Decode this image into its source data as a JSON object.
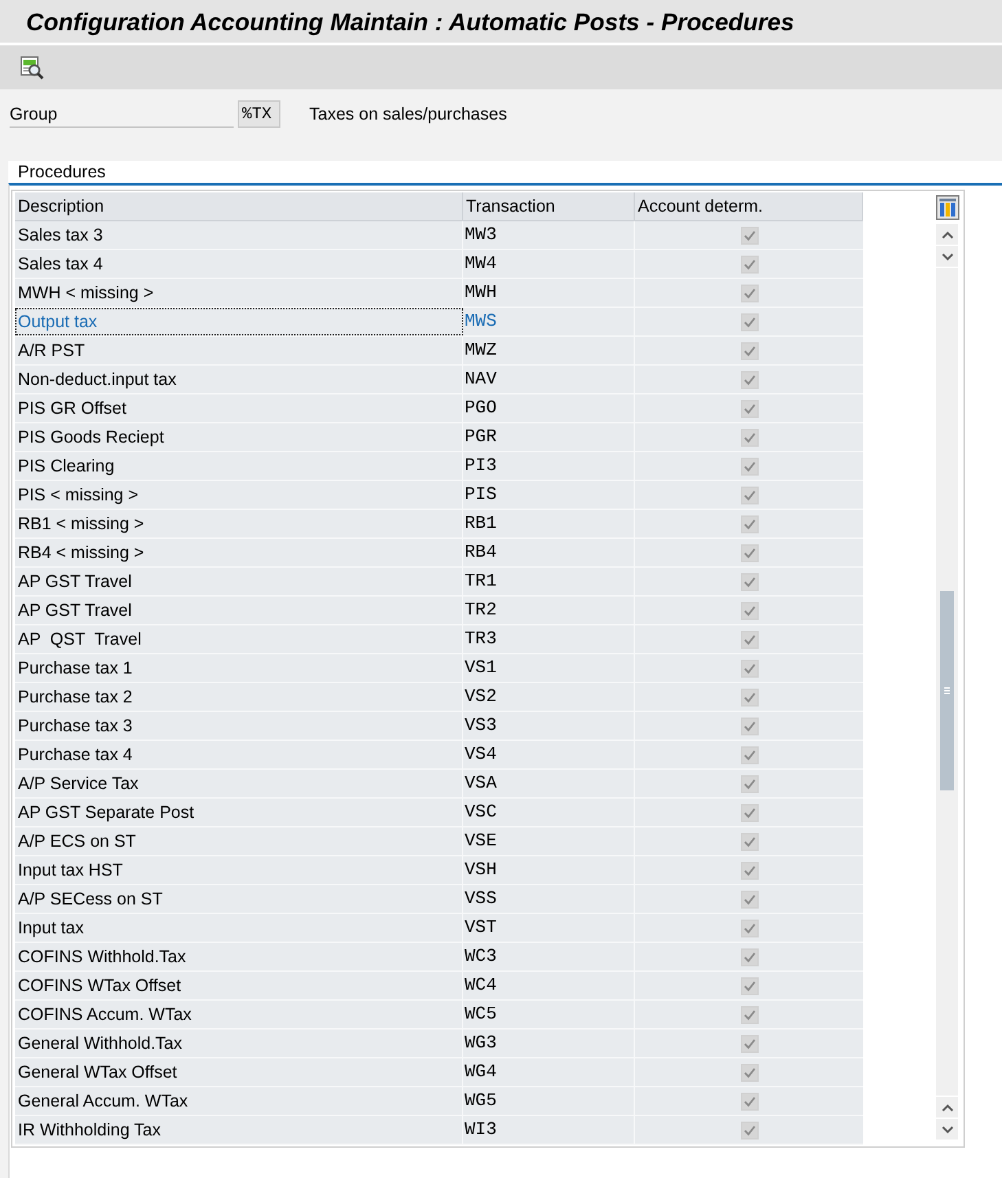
{
  "window": {
    "title": "Configuration Accounting Maintain : Automatic Posts - Procedures"
  },
  "group": {
    "label": "Group",
    "value": "%TX",
    "description": "Taxes on sales/purchases"
  },
  "tabs": [
    {
      "label": "Procedures",
      "selected": true
    }
  ],
  "table": {
    "columns": [
      "Description",
      "Transaction",
      "Account determ."
    ],
    "rows": [
      {
        "description": "Sales tax 3",
        "transaction": "MW3",
        "account_determ": {
          "checked": true,
          "disabled": true
        },
        "selected": false
      },
      {
        "description": "Sales tax 4",
        "transaction": "MW4",
        "account_determ": {
          "checked": true,
          "disabled": true
        },
        "selected": false
      },
      {
        "description": "MWH < missing >",
        "transaction": "MWH",
        "account_determ": {
          "checked": true,
          "disabled": true
        },
        "selected": false
      },
      {
        "description": "Output tax",
        "transaction": "MWS",
        "account_determ": {
          "checked": true,
          "disabled": true
        },
        "selected": true
      },
      {
        "description": "A/R PST",
        "transaction": "MWZ",
        "account_determ": {
          "checked": true,
          "disabled": true
        },
        "selected": false
      },
      {
        "description": "Non-deduct.input tax",
        "transaction": "NAV",
        "account_determ": {
          "checked": true,
          "disabled": true
        },
        "selected": false
      },
      {
        "description": "PIS GR Offset",
        "transaction": "PGO",
        "account_determ": {
          "checked": true,
          "disabled": true
        },
        "selected": false
      },
      {
        "description": "PIS Goods Reciept",
        "transaction": "PGR",
        "account_determ": {
          "checked": true,
          "disabled": true
        },
        "selected": false
      },
      {
        "description": "PIS Clearing",
        "transaction": "PI3",
        "account_determ": {
          "checked": true,
          "disabled": true
        },
        "selected": false
      },
      {
        "description": "PIS < missing >",
        "transaction": "PIS",
        "account_determ": {
          "checked": true,
          "disabled": true
        },
        "selected": false
      },
      {
        "description": "RB1 < missing >",
        "transaction": "RB1",
        "account_determ": {
          "checked": true,
          "disabled": true
        },
        "selected": false
      },
      {
        "description": "RB4 < missing >",
        "transaction": "RB4",
        "account_determ": {
          "checked": true,
          "disabled": true
        },
        "selected": false
      },
      {
        "description": "AP GST Travel",
        "transaction": "TR1",
        "account_determ": {
          "checked": true,
          "disabled": true
        },
        "selected": false
      },
      {
        "description": "AP GST Travel",
        "transaction": "TR2",
        "account_determ": {
          "checked": true,
          "disabled": true
        },
        "selected": false
      },
      {
        "description": "AP  QST  Travel",
        "transaction": "TR3",
        "account_determ": {
          "checked": true,
          "disabled": true
        },
        "selected": false
      },
      {
        "description": "Purchase tax 1",
        "transaction": "VS1",
        "account_determ": {
          "checked": true,
          "disabled": true
        },
        "selected": false
      },
      {
        "description": "Purchase tax 2",
        "transaction": "VS2",
        "account_determ": {
          "checked": true,
          "disabled": true
        },
        "selected": false
      },
      {
        "description": "Purchase tax 3",
        "transaction": "VS3",
        "account_determ": {
          "checked": true,
          "disabled": true
        },
        "selected": false
      },
      {
        "description": "Purchase tax 4",
        "transaction": "VS4",
        "account_determ": {
          "checked": true,
          "disabled": true
        },
        "selected": false
      },
      {
        "description": "A/P Service Tax",
        "transaction": "VSA",
        "account_determ": {
          "checked": true,
          "disabled": true
        },
        "selected": false
      },
      {
        "description": "AP GST Separate Post",
        "transaction": "VSC",
        "account_determ": {
          "checked": true,
          "disabled": true
        },
        "selected": false
      },
      {
        "description": "A/P ECS on ST",
        "transaction": "VSE",
        "account_determ": {
          "checked": true,
          "disabled": true
        },
        "selected": false
      },
      {
        "description": "Input tax HST",
        "transaction": "VSH",
        "account_determ": {
          "checked": true,
          "disabled": true
        },
        "selected": false
      },
      {
        "description": "A/P SECess on ST",
        "transaction": "VSS",
        "account_determ": {
          "checked": true,
          "disabled": true
        },
        "selected": false
      },
      {
        "description": "Input tax",
        "transaction": "VST",
        "account_determ": {
          "checked": true,
          "disabled": true
        },
        "selected": false
      },
      {
        "description": "COFINS Withhold.Tax",
        "transaction": "WC3",
        "account_determ": {
          "checked": true,
          "disabled": true
        },
        "selected": false
      },
      {
        "description": "COFINS WTax Offset",
        "transaction": "WC4",
        "account_determ": {
          "checked": true,
          "disabled": true
        },
        "selected": false
      },
      {
        "description": "COFINS Accum. WTax",
        "transaction": "WC5",
        "account_determ": {
          "checked": true,
          "disabled": true
        },
        "selected": false
      },
      {
        "description": "General Withhold.Tax",
        "transaction": "WG3",
        "account_determ": {
          "checked": true,
          "disabled": true
        },
        "selected": false
      },
      {
        "description": "General WTax Offset",
        "transaction": "WG4",
        "account_determ": {
          "checked": true,
          "disabled": true
        },
        "selected": false
      },
      {
        "description": "General Accum. WTax",
        "transaction": "WG5",
        "account_determ": {
          "checked": true,
          "disabled": true
        },
        "selected": false
      },
      {
        "description": "IR Withholding Tax",
        "transaction": "WI3",
        "account_determ": {
          "checked": true,
          "disabled": true
        },
        "selected": false
      }
    ]
  }
}
